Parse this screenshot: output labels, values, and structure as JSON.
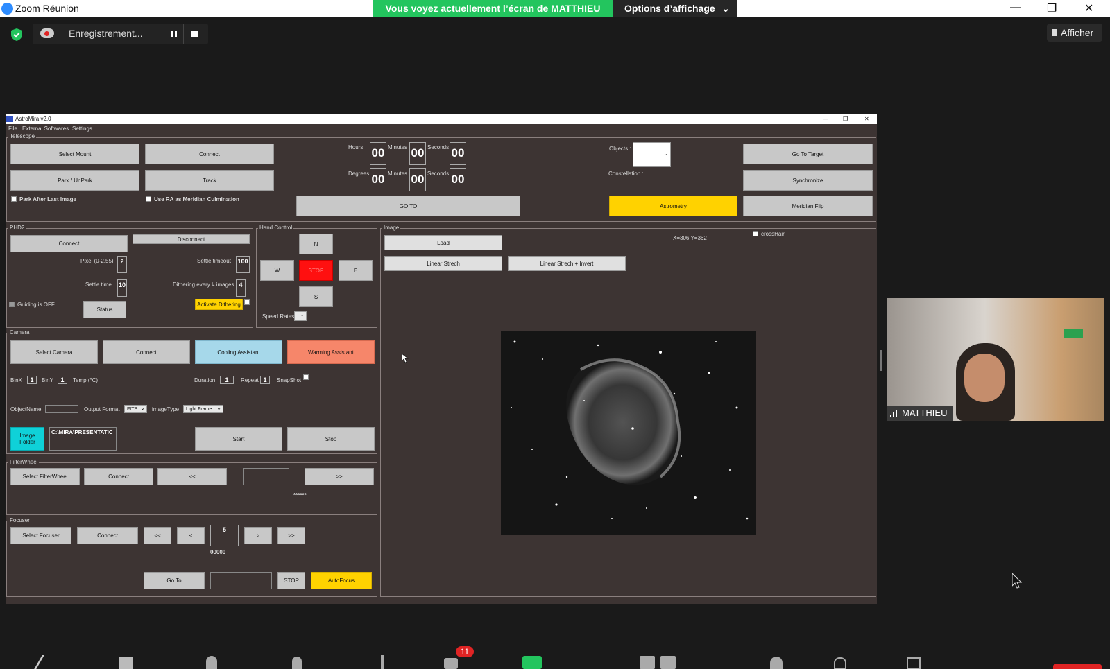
{
  "zoom": {
    "title": "Zoom Réunion",
    "banner": "Vous voyez actuellement l’écran de MATTHIEU",
    "display_options": "Options d’affichage",
    "recording": "Enregistrement...",
    "afficher": "Afficher",
    "participant_name": "MATTHIEU",
    "toolbar_badge": "11"
  },
  "app": {
    "title": "AstroMira v2.0",
    "menu": [
      "File",
      "External Softwares",
      "Settings"
    ],
    "telescope": {
      "group": "Telescope",
      "select_mount": "Select Mount",
      "connect": "Connect",
      "park": "Park / UnPark",
      "track": "Track",
      "park_after": "Park After Last Image",
      "use_ra": "Use RA as Meridian Culmination",
      "hours_label": "Hours",
      "minutes_label": "Minutes",
      "seconds_label": "Seconds",
      "degrees_label": "Degrees",
      "hours": "00",
      "minutes": "00",
      "seconds": "00",
      "degrees": "00",
      "dminutes": "00",
      "dseconds": "00",
      "goto": "GO TO",
      "objects_label": "Objects :",
      "constellation_label": "Constellation :",
      "astrometry": "Astrometry",
      "go_to_target": "Go To Target",
      "synchronize": "Synchronize",
      "meridian_flip": "Meridian Flip"
    },
    "phd2": {
      "group": "PHD2",
      "connect": "Connect",
      "disconnect": "Disconnect",
      "pixel_label": "Pixel (0-2.55)",
      "pixel": "2",
      "settle_timeout_label": "Settle timeout",
      "settle_timeout": "100",
      "settle_time_label": "Settle time",
      "settle_time": "10",
      "dithering_label": "Dithering every # images",
      "dithering": "4",
      "guiding": "Guiding is OFF",
      "status": "Status",
      "activate_dithering": "Activate Dithering"
    },
    "hand": {
      "group": "Hand Control",
      "n": "N",
      "w": "W",
      "stop": "STOP",
      "e": "E",
      "s": "S",
      "speed_rates": "Speed Rates"
    },
    "image": {
      "group": "Image",
      "load": "Load",
      "linear": "Linear Strech",
      "linear_invert": "Linear Strech + Invert",
      "coords": "X=306 Y=362",
      "crosshair": "crossHair"
    },
    "camera": {
      "group": "Camera",
      "select": "Select Camera",
      "connect": "Connect",
      "cooling": "Cooling Assistant",
      "warming": "Warming Assistant",
      "binx_label": "BinX",
      "binx": "1",
      "biny_label": "BinY",
      "biny": "1",
      "temp_label": "Temp (°C)",
      "duration_label": "Duration",
      "duration": "1",
      "repeat_label": "Repeat",
      "repeat": "1",
      "snapshot_label": "SnapShot",
      "objectname_label": "ObjectName",
      "output_label": "Output Format",
      "output": "FITS",
      "imagetype_label": "imageType",
      "imagetype": "Light Frame",
      "image_folder": "Image Folder",
      "folder_path": "C:\\MIRA\\PRESENTATIC",
      "start": "Start",
      "stop": "Stop"
    },
    "filterwheel": {
      "group": "FilterWheel",
      "select": "Select FilterWheel",
      "connect": "Connect",
      "prev": "<<",
      "next": ">>",
      "stars": "******"
    },
    "focuser": {
      "group": "Focuser",
      "select": "Select Focuser",
      "connect": "Connect",
      "ff_back": "<<",
      "back": "<",
      "step": "5",
      "fwd": ">",
      "ff_fwd": ">>",
      "position": "00000",
      "goto": "Go To",
      "stop": "STOP",
      "autofocus": "AutoFocus"
    }
  },
  "colors": {
    "yellow": "#ffd200",
    "red": "#ff1010",
    "cyan": "#0fd1d8",
    "cooling": "#a6d8ea",
    "warming": "#f6866a",
    "green": "#23c55e"
  }
}
